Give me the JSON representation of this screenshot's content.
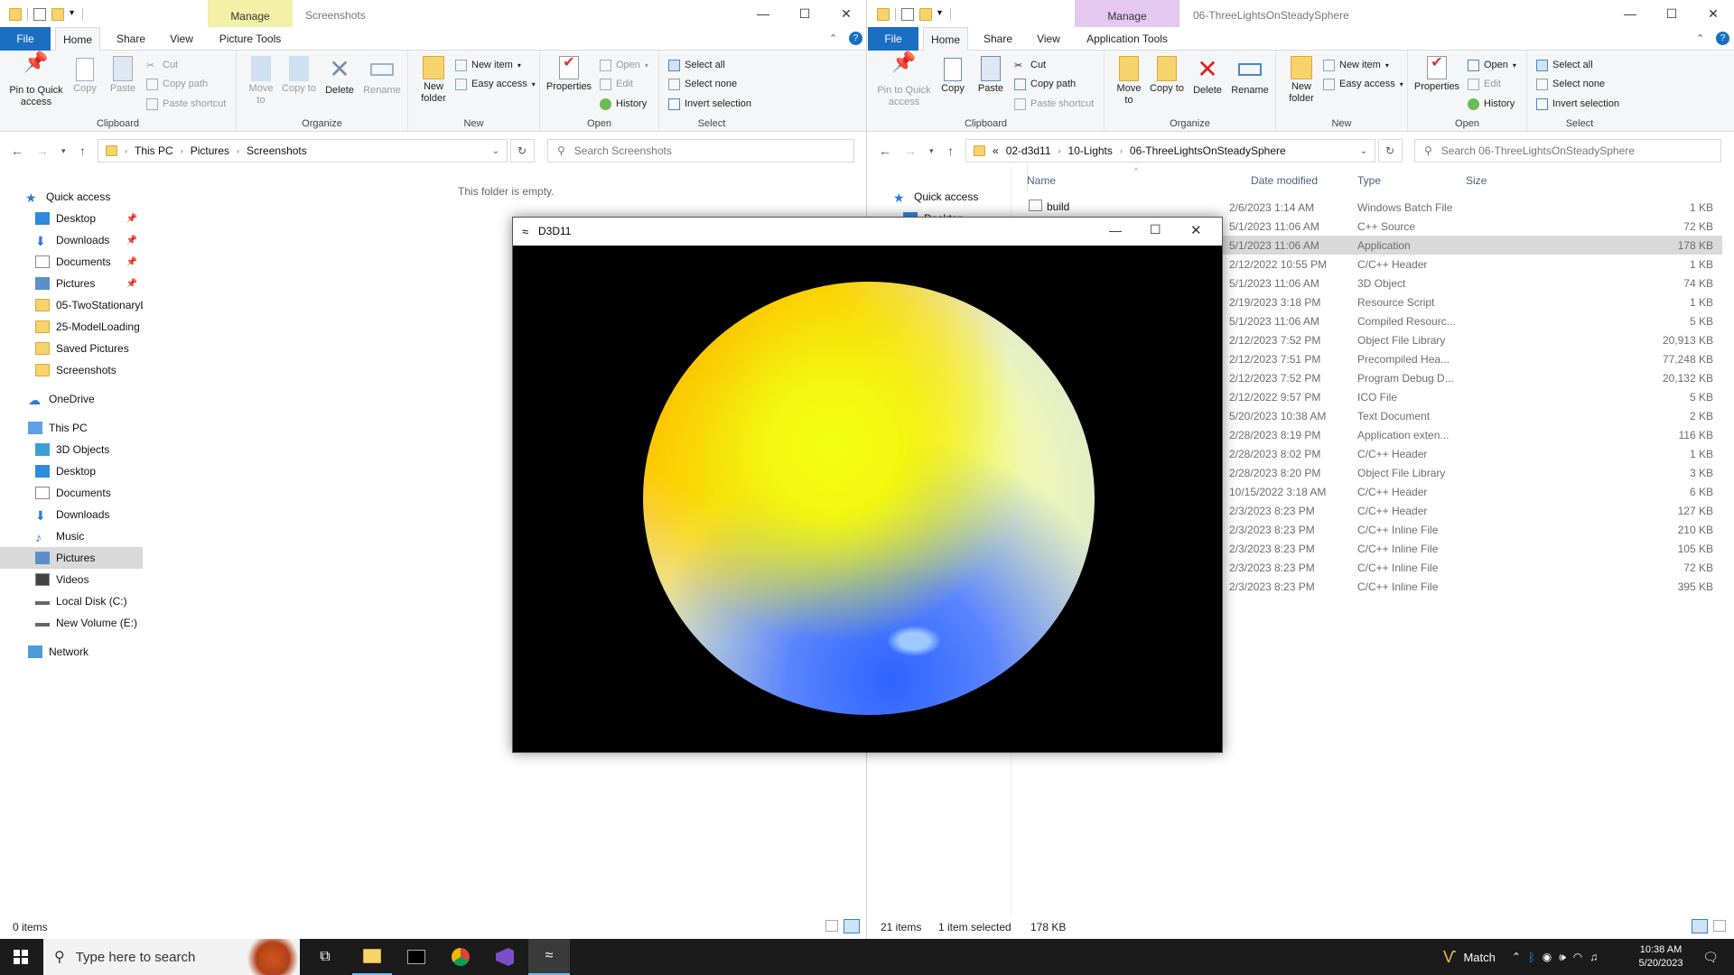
{
  "left": {
    "manage_label": "Manage",
    "window_title": "Screenshots",
    "tabs": {
      "file": "File",
      "home": "Home",
      "share": "Share",
      "view": "View",
      "context": "Picture Tools"
    },
    "ribbon": {
      "pin": "Pin to Quick access",
      "copy": "Copy",
      "paste": "Paste",
      "cut": "Cut",
      "copy_path": "Copy path",
      "paste_shortcut": "Paste shortcut",
      "clipboard": "Clipboard",
      "move_to": "Move to",
      "copy_to": "Copy to",
      "delete": "Delete",
      "rename": "Rename",
      "organize": "Organize",
      "new_folder": "New folder",
      "new_item": "New item",
      "easy_access": "Easy access",
      "new": "New",
      "properties": "Properties",
      "open": "Open",
      "edit": "Edit",
      "history": "History",
      "open_group": "Open",
      "select_all": "Select all",
      "select_none": "Select none",
      "invert_selection": "Invert selection",
      "select_group": "Select"
    },
    "breadcrumb": [
      "This PC",
      "Pictures",
      "Screenshots"
    ],
    "search_placeholder": "Search Screenshots",
    "nav": {
      "quick_access": "Quick access",
      "items": [
        "Desktop",
        "Downloads",
        "Documents",
        "Pictures",
        "05-TwoStationaryLig",
        "25-ModelLoading",
        "Saved Pictures",
        "Screenshots"
      ],
      "onedrive": "OneDrive",
      "this_pc": "This PC",
      "pc_items": [
        "3D Objects",
        "Desktop",
        "Documents",
        "Downloads",
        "Music",
        "Pictures",
        "Videos",
        "Local Disk (C:)",
        "New Volume (E:)"
      ],
      "network": "Network"
    },
    "empty_message": "This folder is empty.",
    "status": "0 items"
  },
  "right": {
    "manage_label": "Manage",
    "window_title": "06-ThreeLightsOnSteadySphere",
    "tabs": {
      "file": "File",
      "home": "Home",
      "share": "Share",
      "view": "View",
      "context": "Application Tools"
    },
    "ribbon": {
      "pin": "Pin to Quick access",
      "copy": "Copy",
      "paste": "Paste",
      "cut": "Cut",
      "copy_path": "Copy path",
      "paste_shortcut": "Paste shortcut",
      "clipboard": "Clipboard",
      "move_to": "Move to",
      "copy_to": "Copy to",
      "delete": "Delete",
      "rename": "Rename",
      "organize": "Organize",
      "new_folder": "New folder",
      "new_item": "New item",
      "easy_access": "Easy access",
      "new": "New",
      "properties": "Properties",
      "open": "Open",
      "edit": "Edit",
      "history": "History",
      "open_group": "Open",
      "select_all": "Select all",
      "select_none": "Select none",
      "invert_selection": "Invert selection",
      "select_group": "Select"
    },
    "breadcrumb_prefix": "«",
    "breadcrumb": [
      "02-d3d11",
      "10-Lights",
      "06-ThreeLightsOnSteadySphere"
    ],
    "search_placeholder": "Search 06-ThreeLightsOnSteadySphere",
    "nav": {
      "quick_access": "Quick access",
      "desktop": "Desktop"
    },
    "columns": {
      "name": "Name",
      "date": "Date modified",
      "type": "Type",
      "size": "Size"
    },
    "first_file": "build",
    "files": [
      {
        "date": "2/6/2023 1:14 AM",
        "type": "Windows Batch File",
        "size": "1 KB"
      },
      {
        "date": "5/1/2023 11:06 AM",
        "type": "C++ Source",
        "size": "72 KB"
      },
      {
        "date": "5/1/2023 11:06 AM",
        "type": "Application",
        "size": "178 KB"
      },
      {
        "date": "2/12/2022 10:55 PM",
        "type": "C/C++ Header",
        "size": "1 KB"
      },
      {
        "date": "5/1/2023 11:06 AM",
        "type": "3D Object",
        "size": "74 KB"
      },
      {
        "date": "2/19/2023 3:18 PM",
        "type": "Resource Script",
        "size": "1 KB"
      },
      {
        "date": "5/1/2023 11:06 AM",
        "type": "Compiled Resourc...",
        "size": "5 KB"
      },
      {
        "date": "2/12/2023 7:52 PM",
        "type": "Object File Library",
        "size": "20,913 KB"
      },
      {
        "date": "2/12/2023 7:51 PM",
        "type": "Precompiled Hea...",
        "size": "77,248 KB"
      },
      {
        "date": "2/12/2023 7:52 PM",
        "type": "Program Debug D...",
        "size": "20,132 KB"
      },
      {
        "date": "2/12/2022 9:57 PM",
        "type": "ICO File",
        "size": "5 KB"
      },
      {
        "date": "5/20/2023 10:38 AM",
        "type": "Text Document",
        "size": "2 KB"
      },
      {
        "date": "2/28/2023 8:19 PM",
        "type": "Application exten...",
        "size": "116 KB"
      },
      {
        "date": "2/28/2023 8:02 PM",
        "type": "C/C++ Header",
        "size": "1 KB"
      },
      {
        "date": "2/28/2023 8:20 PM",
        "type": "Object File Library",
        "size": "3 KB"
      },
      {
        "date": "10/15/2022 3:18 AM",
        "type": "C/C++ Header",
        "size": "6 KB"
      },
      {
        "date": "2/3/2023 8:23 PM",
        "type": "C/C++ Header",
        "size": "127 KB"
      },
      {
        "date": "2/3/2023 8:23 PM",
        "type": "C/C++ Inline File",
        "size": "210 KB"
      },
      {
        "date": "2/3/2023 8:23 PM",
        "type": "C/C++ Inline File",
        "size": "105 KB"
      },
      {
        "date": "2/3/2023 8:23 PM",
        "type": "C/C++ Inline File",
        "size": "72 KB"
      },
      {
        "date": "2/3/2023 8:23 PM",
        "type": "C/C++ Inline File",
        "size": "395 KB"
      }
    ],
    "status_items": "21 items",
    "status_selected": "1 item selected",
    "status_size": "178 KB"
  },
  "d3d_window": {
    "title": "D3D11"
  },
  "taskbar": {
    "search_placeholder": "Type here to search",
    "weather_label": "Match",
    "time": "10:38 AM",
    "date": "5/20/2023"
  },
  "colors": {
    "file_tab": "#1a6fc2",
    "manage_left": "#f3f0a8",
    "manage_right": "#e4c8f0",
    "selection": "#d9d9d9",
    "taskbar": "#1b1b1b"
  }
}
